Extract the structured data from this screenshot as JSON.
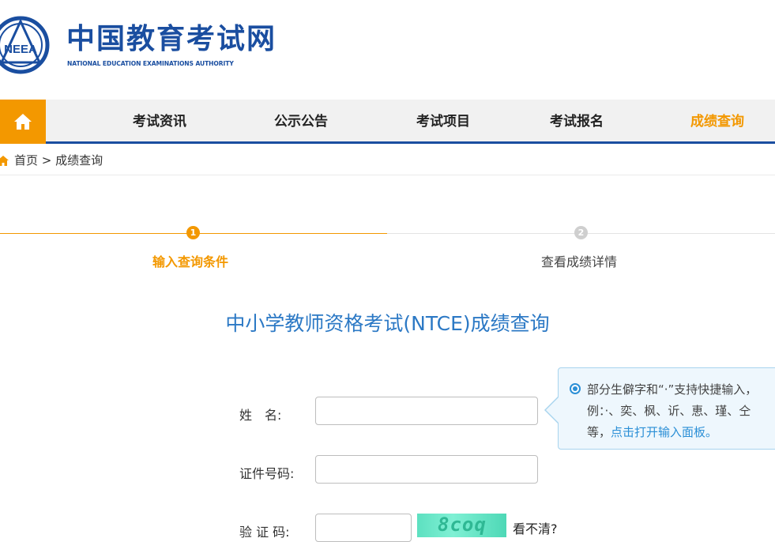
{
  "header": {
    "site_name_cn": "中国教育考试网",
    "site_name_en": "NATIONAL EDUCATION EXAMINATIONS AUTHORITY",
    "emblem_text": "NEEA"
  },
  "nav": {
    "home_icon": "home-icon",
    "items": [
      {
        "label": "考试资讯"
      },
      {
        "label": "公示公告"
      },
      {
        "label": "考试项目"
      },
      {
        "label": "考试报名"
      },
      {
        "label": "成绩查询",
        "active": true
      }
    ]
  },
  "breadcrumb": {
    "icon": "home-icon",
    "text": "首页 > 成绩查询"
  },
  "steps": [
    {
      "number": "1",
      "label": "输入查询条件",
      "active": true
    },
    {
      "number": "2",
      "label": "查看成绩详情",
      "active": false
    }
  ],
  "form": {
    "title": "中小学教师资格考试(NTCE)成绩查询",
    "name_label": "姓　名:",
    "name_value": "",
    "id_label": "证件号码:",
    "id_value": "",
    "captcha_label": "验 证 码:",
    "captcha_value": "",
    "captcha_image_text": "8coq",
    "refresh_label": "看不清?"
  },
  "tooltip": {
    "text_before": "部分生僻字和“·”支持快捷输入，例：·、奕、枫、䜣、恵、瑾、仝等，",
    "link_text": "点击打开输入面板。"
  },
  "colors": {
    "brand_blue": "#1a4ea0",
    "accent_orange": "#f39800",
    "title_blue": "#2c79c5"
  }
}
